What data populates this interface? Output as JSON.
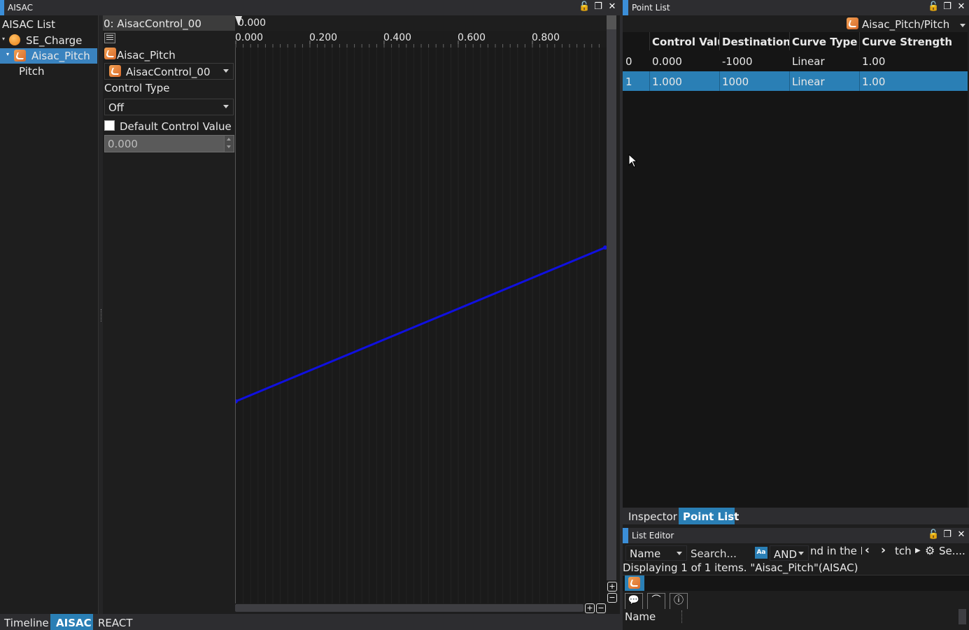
{
  "left_window": {
    "title": "AISAC",
    "list_header": "AISAC List",
    "tree": [
      {
        "label": "SE_Charge",
        "selected": false
      },
      {
        "label": "Aisac_Pitch",
        "selected": true
      },
      {
        "label": "Pitch",
        "selected": false
      }
    ]
  },
  "editor": {
    "control_header": "0: AisacControl_00",
    "cursor_value": "0.000",
    "ruler_ticks": [
      "0.000",
      "0.200",
      "0.400",
      "0.600",
      "0.800"
    ],
    "aisac_name": "Aisac_Pitch",
    "control_select": "AisacControl_00",
    "control_type_label": "Control Type",
    "control_type_value": "Off",
    "default_checkbox_label": "Default Control Value",
    "default_value": "0.000"
  },
  "curve": {
    "x_range": [
      0,
      1
    ],
    "y_range": [
      -1000,
      1000
    ],
    "points": [
      {
        "x": 0.0,
        "y": -1000
      },
      {
        "x": 1.0,
        "y": 1000
      }
    ],
    "color": "#1010e0"
  },
  "bottom_tabs": [
    "Timeline",
    "AISAC",
    "REACT"
  ],
  "active_bottom_tab": "AISAC",
  "point_list": {
    "title": "Point List",
    "path": "Aisac_Pitch/Pitch",
    "columns": [
      "Control Value",
      "Destination V",
      "Curve Type",
      "Curve Strength"
    ],
    "rows": [
      {
        "index": "0",
        "control": "0.000",
        "dest": "-1000",
        "curve": "Linear",
        "strength": "1.00"
      },
      {
        "index": "1",
        "control": "1.000",
        "dest": "1000",
        "curve": "Linear",
        "strength": "1.00"
      }
    ],
    "selected_row": 1
  },
  "right_tabs": [
    "Inspector",
    "Point List"
  ],
  "active_right_tab": "Point List",
  "list_editor": {
    "title": "List Editor",
    "field_select": "Name",
    "search_placeholder": "Search...",
    "match_case_icon": "Aa",
    "logic_select": "AND",
    "find_text": "nd in the Li",
    "nav_text": "tch",
    "settings_text": "Se....",
    "status": "Displaying 1 of 1 items. \"Aisac_Pitch\"(AISAC)",
    "column_name": "Name"
  },
  "colors": {
    "accent": "#3b8ed8",
    "selection": "#2a7fb5",
    "tree_selection": "#3a83bf",
    "curve": "#1010e0"
  }
}
